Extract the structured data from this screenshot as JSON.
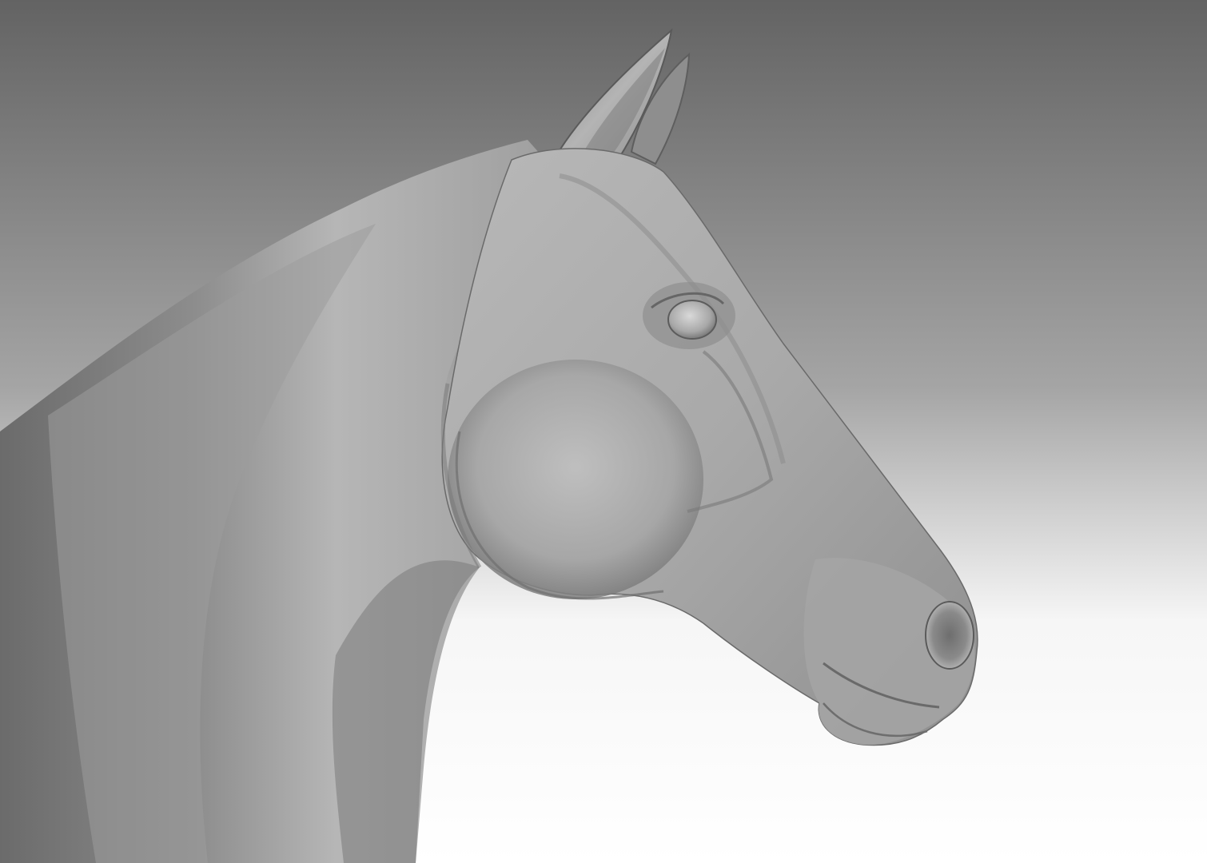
{
  "scene": {
    "subject": "horse-head-sculpt",
    "background_top_color": "#636363",
    "background_bottom_color": "#ffffff",
    "material_color": "#9a9a9a"
  }
}
